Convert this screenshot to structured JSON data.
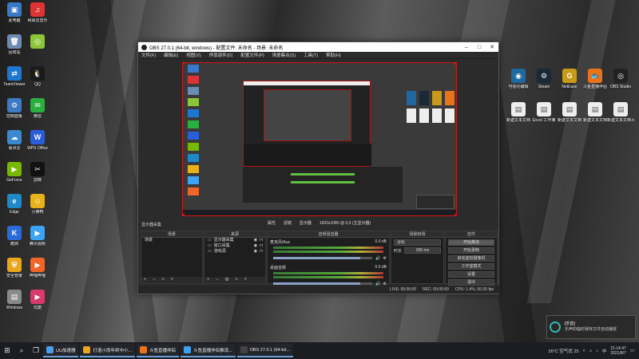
{
  "desktop_left": [
    {
      "label": "此电脑",
      "color": "#3a78c8",
      "glyph": "▣"
    },
    {
      "label": "网易云音乐",
      "color": "#d33",
      "glyph": "♫"
    },
    {
      "label": "回收站",
      "color": "#6b8bb0",
      "glyph": "🗑"
    },
    {
      "label": "",
      "color": "#8cc43a",
      "glyph": "◎"
    },
    {
      "label": "TeamViewer",
      "color": "#1e78d0",
      "glyph": "⇄"
    },
    {
      "label": "QQ",
      "color": "#1a1a1a",
      "glyph": "🐧"
    },
    {
      "label": "控制面板",
      "color": "#3c7bc4",
      "glyph": "⚙"
    },
    {
      "label": "微信",
      "color": "#2aae3e",
      "glyph": "✉"
    },
    {
      "label": "易点云",
      "color": "#3b8ad0",
      "glyph": "☁"
    },
    {
      "label": "WPS Office",
      "color": "#2a5ed8",
      "glyph": "W"
    },
    {
      "label": "GeForce",
      "color": "#76b900",
      "glyph": "▶"
    },
    {
      "label": "剪映",
      "color": "#111",
      "glyph": "✂"
    },
    {
      "label": "Edge",
      "color": "#1e88c8",
      "glyph": "e"
    },
    {
      "label": "小黄鸭",
      "color": "#e8b21a",
      "glyph": "☺"
    },
    {
      "label": "酷狗",
      "color": "#2a6bd8",
      "glyph": "K"
    },
    {
      "label": "腾讯视频",
      "color": "#3ca4f0",
      "glyph": "▶"
    },
    {
      "label": "安全管家",
      "color": "#e8a61a",
      "glyph": "⛨"
    },
    {
      "label": "哔哩哔哩",
      "color": "#f0662a",
      "glyph": "▶"
    },
    {
      "label": "Windows",
      "color": "#8a8a8a",
      "glyph": "▤"
    },
    {
      "label": "优酷",
      "color": "#d83a6a",
      "glyph": "▶"
    }
  ],
  "desktop_right": [
    {
      "label": "可视化编辑",
      "color": "#1e6aa0",
      "glyph": "◉"
    },
    {
      "label": "Steam",
      "color": "#1b2838",
      "glyph": "⚙"
    },
    {
      "label": "NetEase",
      "color": "#c89a1a",
      "glyph": "G"
    },
    {
      "label": "斗鱼直播伴侣",
      "color": "#e8731a",
      "glyph": "🐟"
    },
    {
      "label": "OBS Studio",
      "color": "#222",
      "glyph": "◎"
    },
    {
      "label": "新建文本文档",
      "color": "#eee",
      "glyph": "▤"
    },
    {
      "label": "Excel 工作簿",
      "color": "#eee",
      "glyph": "▤"
    },
    {
      "label": "新建文本文档",
      "color": "#eee",
      "glyph": "▤"
    },
    {
      "label": "新建文本文档",
      "color": "#eee",
      "glyph": "▤"
    },
    {
      "label": "新建文本文档.txt",
      "color": "#eee",
      "glyph": "▤"
    }
  ],
  "obs": {
    "title": "OBS 27.0.1 (64-bit, windows) - 配置文件: 未命名 - 场景: 未命名",
    "menu": [
      "文件(F)",
      "编辑(E)",
      "视图(V)",
      "停靠部件(D)",
      "配置文件(P)",
      "场景集合(S)",
      "工具(T)",
      "帮助(H)"
    ],
    "toolbar": [
      "属性",
      "滤镜",
      "显示器",
      "1920x1080 @ 0,0 (主显示器)"
    ],
    "dock_title": "显示器采集",
    "scenes_header": "场景",
    "scenes": [
      "场景"
    ],
    "sources_header": "来源",
    "sources": [
      "显示器采集",
      "窗口采集",
      "游戏源"
    ],
    "mixer_header": "音频混音器",
    "mixer": [
      {
        "name": "麦克风/Aux",
        "db": "0.0 dB"
      },
      {
        "name": "桌面音频",
        "db": "0.0 dB"
      }
    ],
    "transitions_header": "场景转场",
    "transition_type": "淡化",
    "duration_label": "时长",
    "duration_value": "300 ms",
    "controls_header": "控件",
    "controls": [
      "开始推流",
      "开始录制",
      "启动虚拟摄像机",
      "工作室模式",
      "设置",
      "退出"
    ],
    "status": [
      "LIVE: 00:00:00",
      "REC: 00:00:00",
      "CPU: 1.4%, 60.00 fps"
    ]
  },
  "taskbar": {
    "apps": [
      {
        "label": "UU加速器",
        "color": "#4aa0e8"
      },
      {
        "label": "打造小而年终中小...",
        "color": "#e8a61a"
      },
      {
        "label": "斗鱼直播伴侣",
        "color": "#e8731a"
      },
      {
        "label": "斗鱼直播伴侣推流...",
        "color": "#3ca4f0"
      },
      {
        "label": "OBS 27.0.1 (64-bit...",
        "color": "#444"
      }
    ],
    "weather": "26°C 空气优 25",
    "ime": "中",
    "time": "21:14:47",
    "date": "2021/8/7"
  },
  "notification": {
    "title": "[乐音]",
    "body": "乐声的临时保存文件自动播放"
  }
}
